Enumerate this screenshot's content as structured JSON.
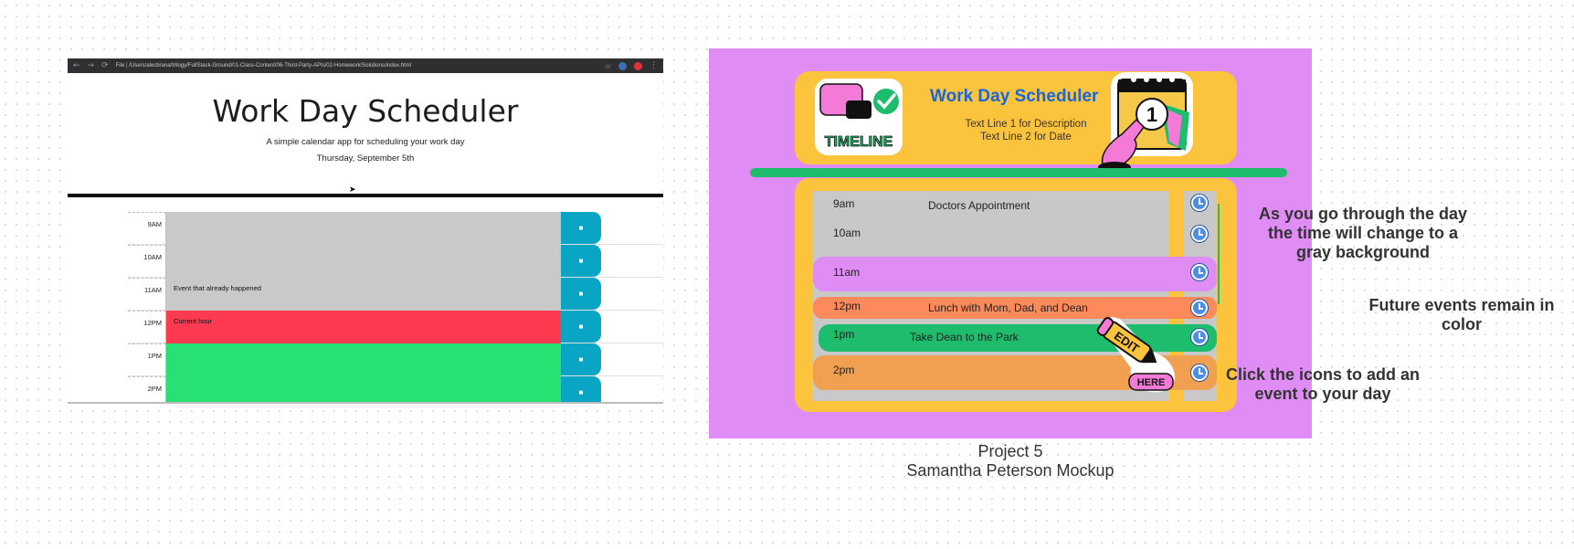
{
  "screenshot": {
    "browser": {
      "url": "File | /Users/alecbrana/trilogy/FullStack-Ground/01-Class-Content/06-Third-Party-APIs/02-Homework/Solutions/index.html",
      "back_glyph": "←",
      "forward_glyph": "→",
      "reload_glyph": "⟳",
      "star_glyph": "☆"
    },
    "title": "Work Day Scheduler",
    "subtitle": "A simple calendar app for scheduling your work day",
    "date": "Thursday, September 5th",
    "save_glyph": "■",
    "rows": [
      {
        "hour": "9AM",
        "text": "",
        "state": "past"
      },
      {
        "hour": "10AM",
        "text": "",
        "state": "past"
      },
      {
        "hour": "11AM",
        "text": "Event that already happened",
        "state": "past"
      },
      {
        "hour": "12PM",
        "text": "Current hour",
        "state": "present"
      },
      {
        "hour": "1PM",
        "text": "",
        "state": "future"
      },
      {
        "hour": "2PM",
        "text": "",
        "state": "future"
      }
    ],
    "colors": {
      "past": "#c9c9c9",
      "present": "#fe3a51",
      "future": "#27e172",
      "save": "#0aa4c4"
    }
  },
  "mockup": {
    "title": "Work Day Scheduler",
    "line1": "Text Line 1  for Description",
    "line2": "Text Line 2 for Date",
    "timeline_sticker": "TIMELINE",
    "calendar_number": "1",
    "edit_sticker": "EDIT",
    "here_sticker": "HERE",
    "rows": [
      {
        "time": "9am",
        "event": "Doctors Appointment",
        "color": "#c8c8c8"
      },
      {
        "time": "10am",
        "event": "",
        "color": "#c8c8c8"
      },
      {
        "time": "11am",
        "event": "",
        "color": "#df8df4"
      },
      {
        "time": "12pm",
        "event": "Lunch with Mom, Dad, and Dean",
        "color": "#fd8a5a"
      },
      {
        "time": "1pm",
        "event": "Take Dean to the Park",
        "color": "#1ebc6d"
      },
      {
        "time": "2pm",
        "event": "",
        "color": "#f0a050"
      }
    ],
    "icons": [
      "clock-icon",
      "check-icon",
      "calendar-icon",
      "pencil-icon"
    ]
  },
  "annotations": {
    "gray_note": [
      "As you go through the day",
      "the time will change to a",
      "gray background"
    ],
    "color_note": [
      "Future events remain in",
      "color"
    ],
    "icon_note": [
      "Click the icons to add an",
      "event to your day"
    ]
  },
  "caption": {
    "line1": "Project 5",
    "line2": "Samantha Peterson Mockup"
  }
}
